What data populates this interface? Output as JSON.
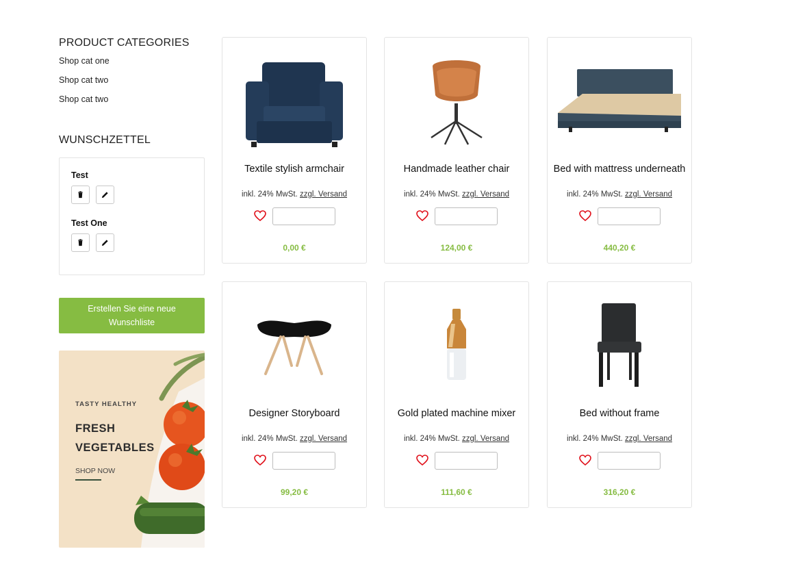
{
  "sidebar": {
    "categories_heading": "PRODUCT CATEGORIES",
    "categories": [
      "Shop cat one",
      "Shop cat two",
      "Shop cat two"
    ],
    "wishlist_heading": "WUNSCHZETTEL",
    "wishlists": [
      {
        "name": "Test"
      },
      {
        "name": "Test One"
      }
    ],
    "create_button": "Erstellen Sie eine neue Wunschliste"
  },
  "banner": {
    "tag": "TASTY HEALTHY",
    "title": "FRESH VEGETABLES",
    "cta": "SHOP NOW"
  },
  "products": [
    {
      "title": "Textile stylish armchair",
      "tax": "inkl. 24% MwSt.",
      "shipping": "zzgl. Versand",
      "price": "0,00 €",
      "image": "armchair"
    },
    {
      "title": "Handmade leather chair",
      "tax": "inkl. 24% MwSt.",
      "shipping": "zzgl. Versand",
      "price": "124,00 €",
      "image": "leather-chair"
    },
    {
      "title": "Bed with mattress underneath",
      "tax": "inkl. 24% MwSt.",
      "shipping": "zzgl. Versand",
      "price": "440,20 €",
      "image": "bed"
    },
    {
      "title": "Designer Storyboard",
      "tax": "inkl. 24% MwSt.",
      "shipping": "zzgl. Versand",
      "price": "99,20 €",
      "image": "stool"
    },
    {
      "title": "Gold plated machine mixer",
      "tax": "inkl. 24% MwSt.",
      "shipping": "zzgl. Versand",
      "price": "111,60 €",
      "image": "mixer"
    },
    {
      "title": "Bed without frame",
      "tax": "inkl. 24% MwSt.",
      "shipping": "zzgl. Versand",
      "price": "316,20 €",
      "image": "dining-chair"
    }
  ],
  "colors": {
    "accent": "#86bc42",
    "heart": "#e0101a",
    "border": "#e3e3e3"
  },
  "icons": {
    "delete": "trash-icon",
    "edit": "pencil-icon",
    "wishlist": "heart-icon"
  }
}
